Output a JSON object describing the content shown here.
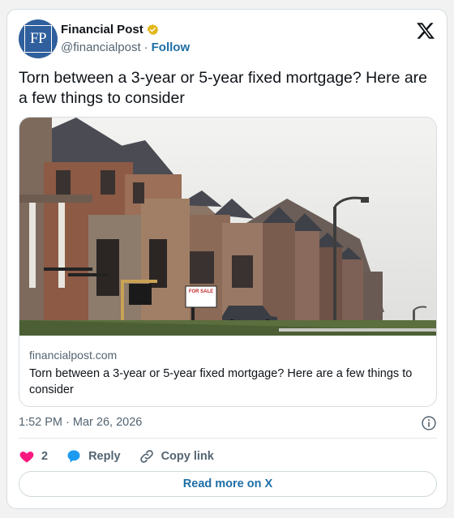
{
  "author": {
    "name": "Financial Post",
    "handle": "@financialpost",
    "separator": "·",
    "follow_label": "Follow",
    "avatar_initials": "FP",
    "avatar_color": "#2f5f9c",
    "verified_badge_color": "#e2b719"
  },
  "tweet": {
    "text": "Torn between a 3-year or 5-year fixed mortgage? Here are a few things to consider"
  },
  "link_card": {
    "image": "row-of-suburban-houses-with-for-sale-sign",
    "domain": "financialpost.com",
    "title": "Torn between a 3-year or 5-year fixed mortgage? Here are a few things to consider",
    "sign_text": "FOR SALE"
  },
  "meta": {
    "timestamp": "1:52 PM · Mar 26, 2026"
  },
  "actions": {
    "like_count": "2",
    "reply_label": "Reply",
    "copy_link_label": "Copy link"
  },
  "read_more_label": "Read more on X",
  "colors": {
    "accent": "#1d6ea6",
    "like": "#f91880",
    "reply": "#1d9bf0",
    "muted": "#536471"
  }
}
